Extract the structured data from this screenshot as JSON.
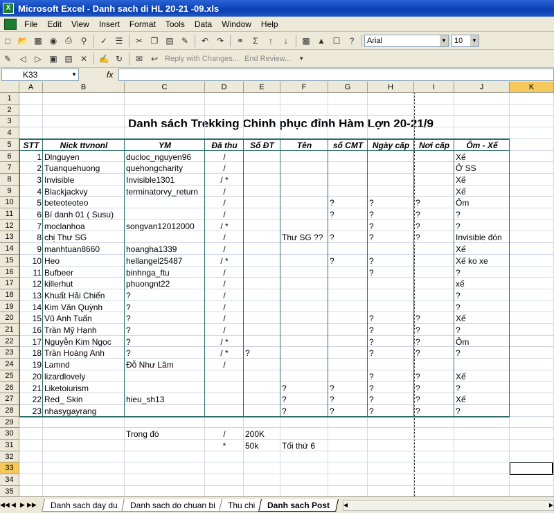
{
  "window": {
    "title": "Microsoft Excel - Danh sach di HL 20-21 -09.xls",
    "app_icon": "excel-icon"
  },
  "menu": [
    "File",
    "Edit",
    "View",
    "Insert",
    "Format",
    "Tools",
    "Data",
    "Window",
    "Help"
  ],
  "toolbar": {
    "font_name": "Arial",
    "font_size": "10",
    "reply_label": "Reply with Changes...",
    "end_review_label": "End Review..."
  },
  "formula_bar": {
    "name_box": "K33",
    "fx_label": "fx",
    "formula": ""
  },
  "columns": [
    "A",
    "B",
    "C",
    "D",
    "E",
    "F",
    "G",
    "H",
    "I",
    "J",
    "K"
  ],
  "rows": [
    "1",
    "2",
    "3",
    "4",
    "5",
    "6",
    "7",
    "8",
    "9",
    "10",
    "11",
    "12",
    "13",
    "14",
    "15",
    "16",
    "17",
    "18",
    "19",
    "20",
    "21",
    "22",
    "23",
    "24",
    "25",
    "26",
    "27",
    "28",
    "29",
    "30",
    "31",
    "32",
    "33",
    "34",
    "35"
  ],
  "selected": {
    "column": "K",
    "row": "33"
  },
  "sheet": {
    "title": "Danh sách Trekking Chinh phục đỉnh Hàm Lợn 20-21/9",
    "headers": [
      "STT",
      "Nick ttvnonl",
      "YM",
      "Đã thu",
      "Số ĐT",
      "Tên",
      "số CMT",
      "Ngày cấp",
      "Nơi cấp",
      "Ôm - Xế"
    ],
    "data_rows": [
      [
        "1",
        "Dlnguyen",
        "ducloc_nguyen96",
        "/",
        "",
        "",
        "",
        "",
        "",
        "Xế"
      ],
      [
        "2",
        "Tuanquehuong",
        "quehongcharity",
        "/",
        "",
        "",
        "",
        "",
        "",
        "Ở SS"
      ],
      [
        "3",
        "Invisible",
        "Invisible1301",
        "/ *",
        "",
        "",
        "",
        "",
        "",
        "Xế"
      ],
      [
        "4",
        "Blackjackvy",
        "terminatorvy_return",
        "/",
        "",
        "",
        "",
        "",
        "",
        "Xế"
      ],
      [
        "5",
        "beteoteoteo",
        "",
        "/",
        "",
        "",
        "?",
        "?",
        "?",
        "Ôm"
      ],
      [
        "6",
        "Bí danh 01 ( Susu)",
        "",
        "/",
        "",
        "",
        "?",
        "?",
        "?",
        "?"
      ],
      [
        "7",
        "moclanhoa",
        "songvan12012000",
        "/ *",
        "",
        "",
        "",
        "?",
        "?",
        "?"
      ],
      [
        "8",
        "chị Thư SG",
        "",
        "/",
        "",
        "Thư SG ??",
        "?",
        "?",
        "?",
        "Invisible đón"
      ],
      [
        "9",
        "manhtuan8660",
        "hoangha1339",
        "/",
        "",
        "",
        "",
        "",
        "",
        "Xế"
      ],
      [
        "10",
        "Heo",
        "hellangel25487",
        "/ *",
        "",
        "",
        "?",
        "?",
        "",
        "Xế ko xe"
      ],
      [
        "11",
        "Bufbeer",
        "binhnga_ftu",
        "/",
        "",
        "",
        "",
        "?",
        "",
        "?"
      ],
      [
        "12",
        "killerhut",
        "phuongnt22",
        "/",
        "",
        "",
        "",
        "",
        "",
        "xế"
      ],
      [
        "13",
        "Khuất Hải Chiến",
        "?",
        "/",
        "",
        "",
        "",
        "",
        "",
        "?"
      ],
      [
        "14",
        "Kim Văn Quỳnh",
        "?",
        "/",
        "",
        "",
        "",
        "",
        "",
        "?"
      ],
      [
        "15",
        "Vũ Anh Tuấn",
        "?",
        "/",
        "",
        "",
        "",
        "?",
        "?",
        "Xế"
      ],
      [
        "16",
        "Trần Mỹ Hạnh",
        "?",
        "/",
        "",
        "",
        "",
        "?",
        "?",
        "?"
      ],
      [
        "17",
        "Nguyễn Kim Ngọc",
        "?",
        "/ *",
        "",
        "",
        "",
        "?",
        "?",
        "Ôm"
      ],
      [
        "18",
        "Trần Hoàng Anh",
        "?",
        "/ *",
        "?",
        "",
        "",
        "?",
        "?",
        "?"
      ],
      [
        "19",
        "Lamnd",
        "Đỗ Như Lâm",
        "/",
        "",
        "",
        "",
        "",
        "",
        ""
      ],
      [
        "20",
        "lizardlovely",
        "",
        "",
        "",
        "",
        "",
        "?",
        "?",
        "Xế"
      ],
      [
        "21",
        "Liketoiurism",
        "",
        "",
        "",
        "?",
        "?",
        "?",
        "?",
        "?"
      ],
      [
        "22",
        "Red_ Skin",
        "hieu_sh13",
        "",
        "",
        "?",
        "?",
        "?",
        "?",
        "Xế"
      ],
      [
        "23",
        "nhasygayrang",
        "",
        "",
        "",
        "?",
        "?",
        "?",
        "?",
        "?"
      ]
    ],
    "summary": [
      {
        "label": "Trong đó",
        "mark": "/",
        "value": "200K",
        "note": ""
      },
      {
        "label": "",
        "mark": "*",
        "value": "50k",
        "note": "Tối thứ 6"
      }
    ]
  },
  "tabs": [
    "Danh sach day du",
    "Danh sach do chuan bi",
    "Thu chi",
    "Danh sach Post"
  ],
  "active_tab": "Danh sach Post"
}
